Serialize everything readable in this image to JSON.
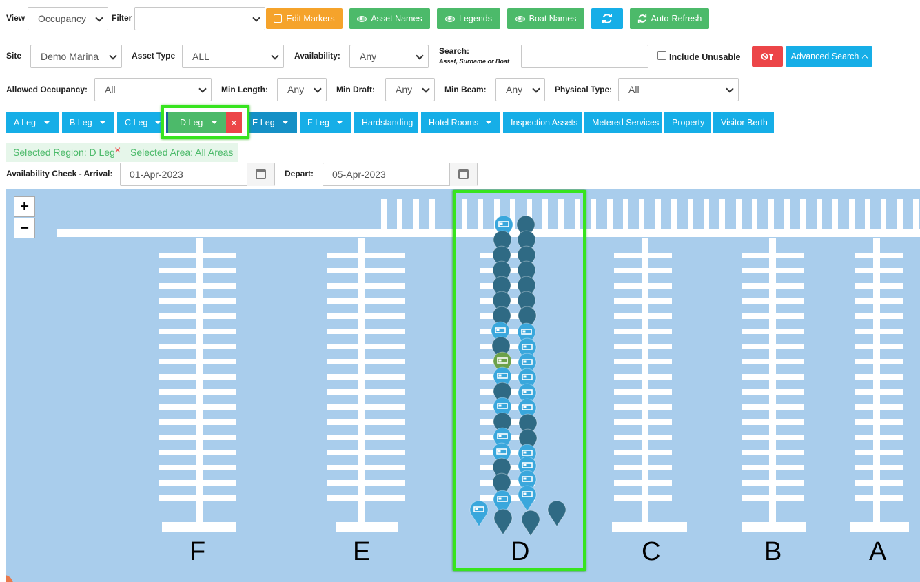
{
  "toolbar": {
    "view_label": "View",
    "view_value": "Occupancy",
    "filter_label": "Filter",
    "filter_value": "",
    "edit_markers": "Edit Markers",
    "asset_names": "Asset Names",
    "legends": "Legends",
    "boat_names": "Boat Names",
    "auto_refresh": "Auto-Refresh"
  },
  "filters": {
    "site_label": "Site",
    "site_value": "Demo Marina",
    "asset_type_label": "Asset Type",
    "asset_type_value": "ALL",
    "availability_label": "Availability:",
    "availability_value": "Any",
    "search_label": "Search:",
    "search_hint": "Asset, Surname or Boat",
    "search_value": "",
    "include_unusable": "Include Unusable",
    "advanced_search": "Advanced Search",
    "allowed_occupancy_label": "Allowed Occupancy:",
    "allowed_occupancy_value": "All",
    "min_length_label": "Min Length:",
    "min_length_value": "Any",
    "min_draft_label": "Min Draft:",
    "min_draft_value": "Any",
    "min_beam_label": "Min Beam:",
    "min_beam_value": "Any",
    "physical_type_label": "Physical Type:",
    "physical_type_value": "All"
  },
  "tabs": [
    {
      "label": "A Leg"
    },
    {
      "label": "B Leg"
    },
    {
      "label": "C Leg"
    },
    {
      "label": "D Leg"
    },
    {
      "label": "E Leg"
    },
    {
      "label": "F Leg"
    },
    {
      "label": "Hardstanding"
    },
    {
      "label": "Hotel Rooms"
    },
    {
      "label": "Inspection Assets"
    },
    {
      "label": "Metered Services"
    },
    {
      "label": "Property"
    },
    {
      "label": "Visitor Berth"
    }
  ],
  "selection": {
    "region": "Selected Region: D Leg",
    "area": "Selected Area: All Areas"
  },
  "availability": {
    "arrival_label": "Availability Check - Arrival:",
    "arrival_value": "01-Apr-2023",
    "depart_label": "Depart:",
    "depart_value": "05-Apr-2023"
  },
  "map": {
    "zoom_in": "+",
    "zoom_out": "−",
    "leg_labels": [
      "F",
      "E",
      "D",
      "C",
      "B",
      "A"
    ]
  },
  "colors": {
    "accent_blue": "#16aee7",
    "success_green": "#4cba6a",
    "warning_orange": "#f5a32b",
    "danger_red": "#ec4548",
    "water": "#a9cdec",
    "highlight": "#37e41e"
  }
}
